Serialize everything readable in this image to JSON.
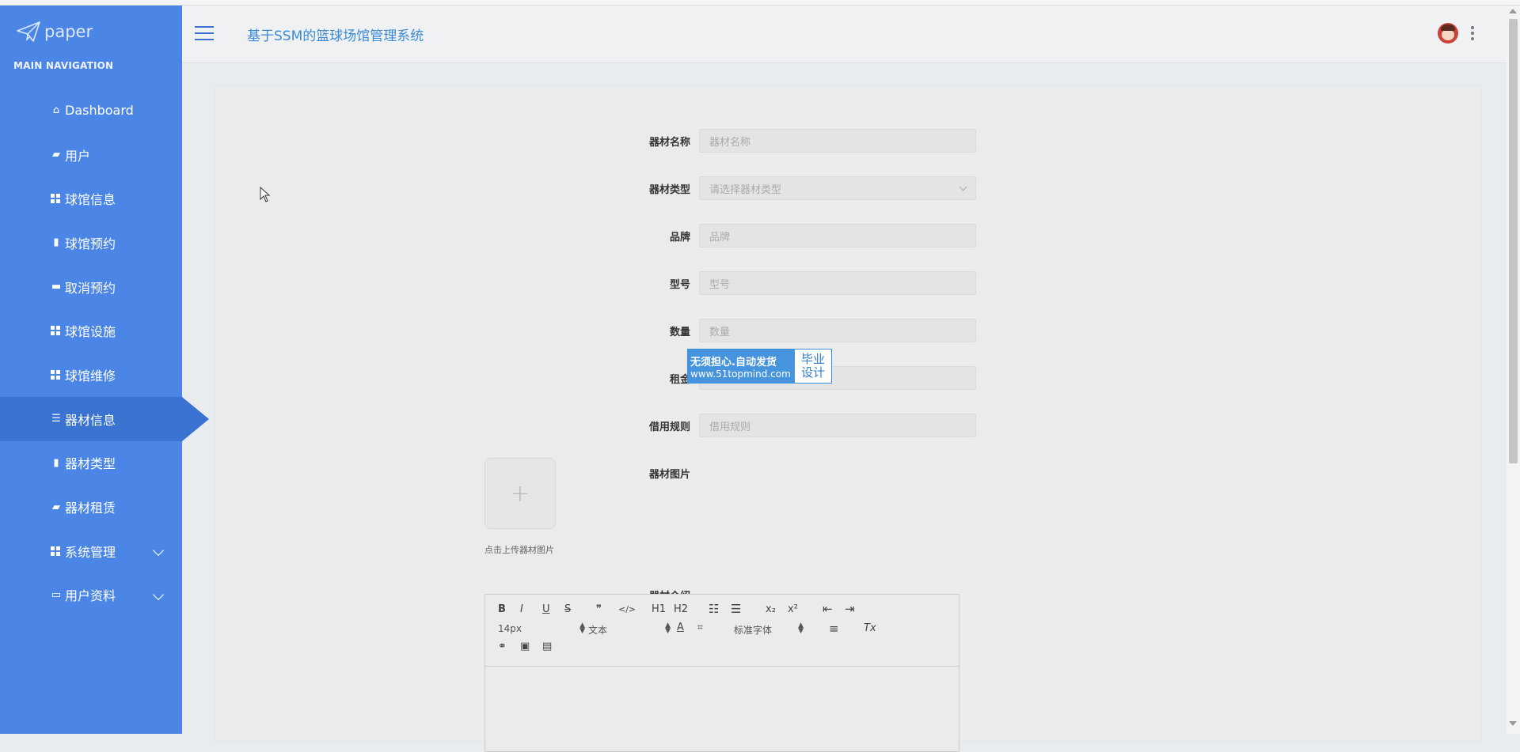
{
  "sidebar": {
    "logo_text": "paper",
    "nav_title": "MAIN NAVIGATION",
    "items": [
      {
        "label": "Dashboard"
      },
      {
        "label": "用户"
      },
      {
        "label": "球馆信息"
      },
      {
        "label": "球馆预约"
      },
      {
        "label": "取消预约"
      },
      {
        "label": "球馆设施"
      },
      {
        "label": "球馆维修"
      },
      {
        "label": "器材信息"
      },
      {
        "label": "器材类型"
      },
      {
        "label": "器材租赁"
      },
      {
        "label": "系统管理"
      },
      {
        "label": "用户资料"
      }
    ],
    "active_item": "器材信息"
  },
  "header": {
    "title": "基于SSM的篮球场馆管理系统"
  },
  "form": {
    "fields": [
      {
        "label": "器材名称",
        "placeholder": "器材名称"
      },
      {
        "label": "器材类型",
        "placeholder": "请选择器材类型"
      },
      {
        "label": "品牌",
        "placeholder": "品牌"
      },
      {
        "label": "型号",
        "placeholder": "型号"
      },
      {
        "label": "数量",
        "placeholder": "数量"
      },
      {
        "label": "租金",
        "placeholder": "租金"
      },
      {
        "label": "借用规则",
        "placeholder": "借用规则"
      }
    ],
    "image_label": "器材图片",
    "upload_plus": "+",
    "upload_tip": "点击上传器材图片",
    "intro_label": "器材介绍",
    "editor": {
      "bold": "B",
      "italic": "I",
      "underline": "U",
      "strike": "S",
      "quote": "❞",
      "code": "</>",
      "h1": "H1",
      "h2": "H2",
      "sub": "x₂",
      "sup": "x²",
      "size": "14px",
      "header": "文本",
      "font": "标准字体",
      "clean": "Tx"
    }
  },
  "watermark": {
    "line1": "无须担心.自动发货",
    "line2": "www.51topmind.com",
    "right1": "毕业",
    "right2": "设计"
  },
  "colors": {
    "sidebar": "#4b86e7",
    "sidebar_active": "#3a73d1",
    "title": "#3a8ad8"
  }
}
